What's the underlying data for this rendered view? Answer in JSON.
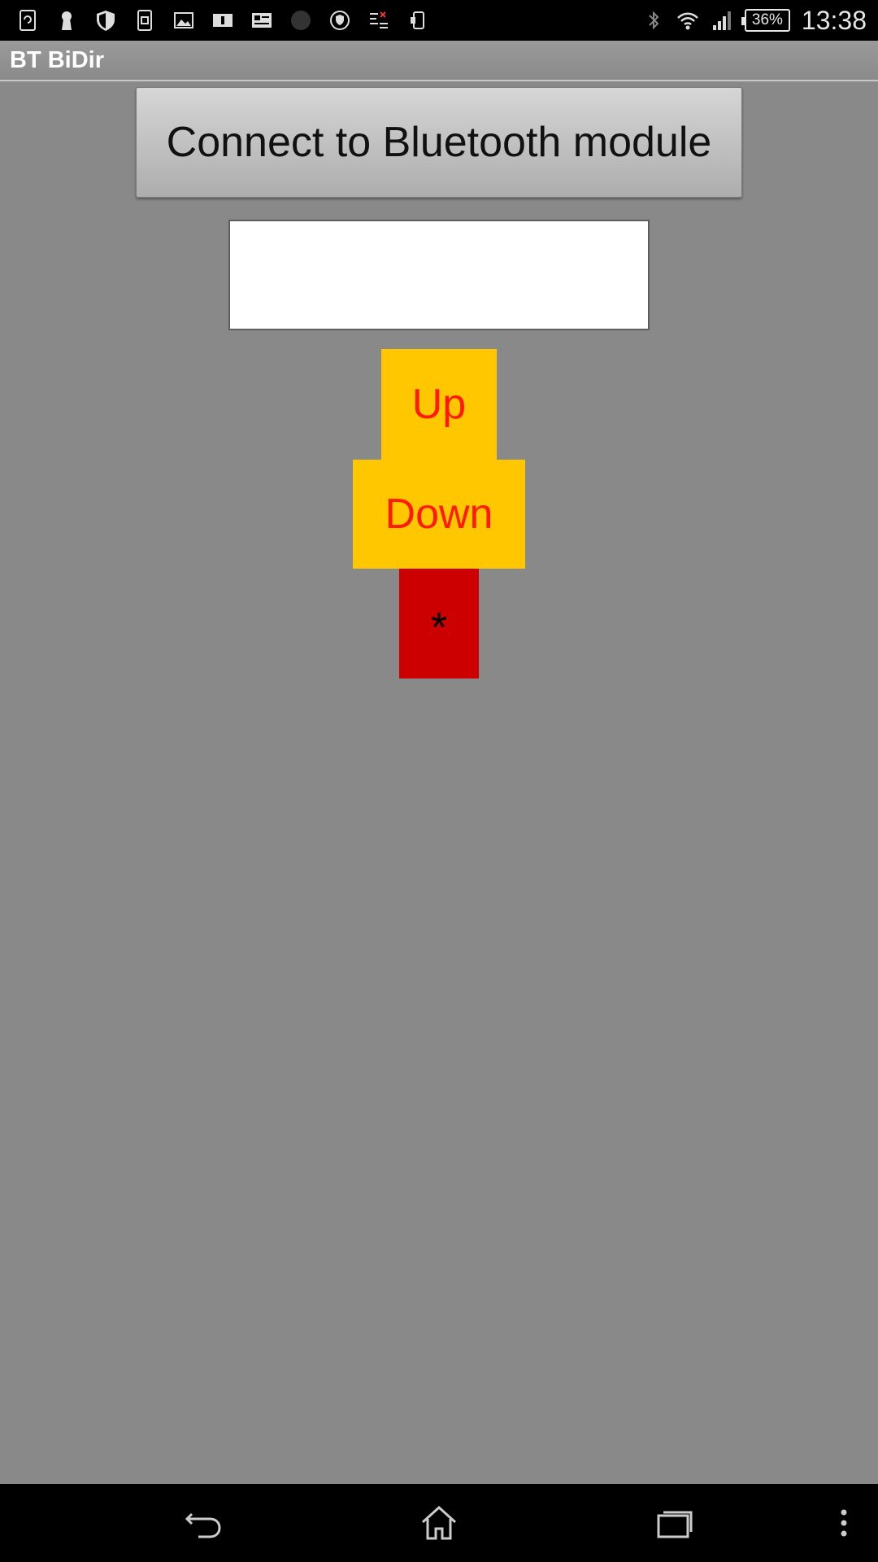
{
  "status_bar": {
    "battery_text": "36%",
    "time": "13:38",
    "left_icons": [
      "sync-icon",
      "keyhole-icon",
      "shield-icon",
      "copy-icon",
      "image-icon",
      "info-card-icon",
      "news-icon",
      "circle-app-icon",
      "shield-badge-icon",
      "list-check-icon",
      "usb-phone-icon"
    ],
    "right_icons": [
      "bluetooth-icon",
      "wifi-icon",
      "signal-icon",
      "battery-icon"
    ]
  },
  "app": {
    "title": "BT BiDir"
  },
  "main": {
    "connect_button_label": "Connect to Bluetooth module",
    "text_field_value": "",
    "up_label": "Up",
    "down_label": "Down",
    "star_label": "*"
  },
  "colors": {
    "background": "#898989",
    "button_yellow": "#ffc700",
    "label_red": "#ff1a00",
    "star_red": "#cc0000"
  },
  "nav_bar": {
    "icons": [
      "back-icon",
      "home-icon",
      "recent-apps-icon",
      "overflow-menu-icon"
    ]
  }
}
